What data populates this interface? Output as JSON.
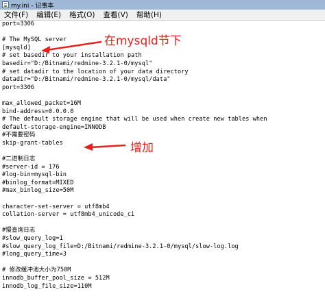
{
  "window": {
    "title": "my.ini - 记事本",
    "icon": "notepad-icon"
  },
  "menubar": {
    "items": [
      "文件(F)",
      "编辑(E)",
      "格式(O)",
      "查看(V)",
      "帮助(H)"
    ]
  },
  "editor": {
    "lines": [
      "port=3306",
      "",
      "# The MySQL server",
      "[mysqld]",
      "# set basedir to your installation path",
      "basedir=\"D:/Bitnami/redmine-3.2.1-0/mysql\"",
      "# set datadir to the location of your data directory",
      "datadir=\"D:/Bitnami/redmine-3.2.1-0/mysql/data\"",
      "port=3306",
      "",
      "max_allowed_packet=16M",
      "bind-address=0.0.0.0",
      "# The default storage engine that will be used when create new tables when",
      "default-storage-engine=INNODB",
      "#不需要密码",
      "skip-grant-tables",
      "",
      "#二进制日志",
      "#server-id = 176",
      "#log-bin=mysql-bin",
      "#binlog_format=MIXED",
      "#max_binlog_size=50M",
      "",
      "character-set-server = utf8mb4",
      "collation-server = utf8mb4_unicode_ci",
      "",
      "#慢查询日志",
      "#slow_query_log=1",
      "#slow_query_log_file=D:/Bitnami/redmine-3.2.1-0/mysql/slow-log.log",
      "#long_query_time=3",
      "",
      "# 修改缓冲池大小为750M",
      "innodb_buffer_pool_size = 512M",
      "innodb_log_file_size=110M"
    ]
  },
  "annotations": {
    "mysqld_section": "在mysqld节下",
    "add_line": "增加",
    "color": "#e8201a"
  }
}
